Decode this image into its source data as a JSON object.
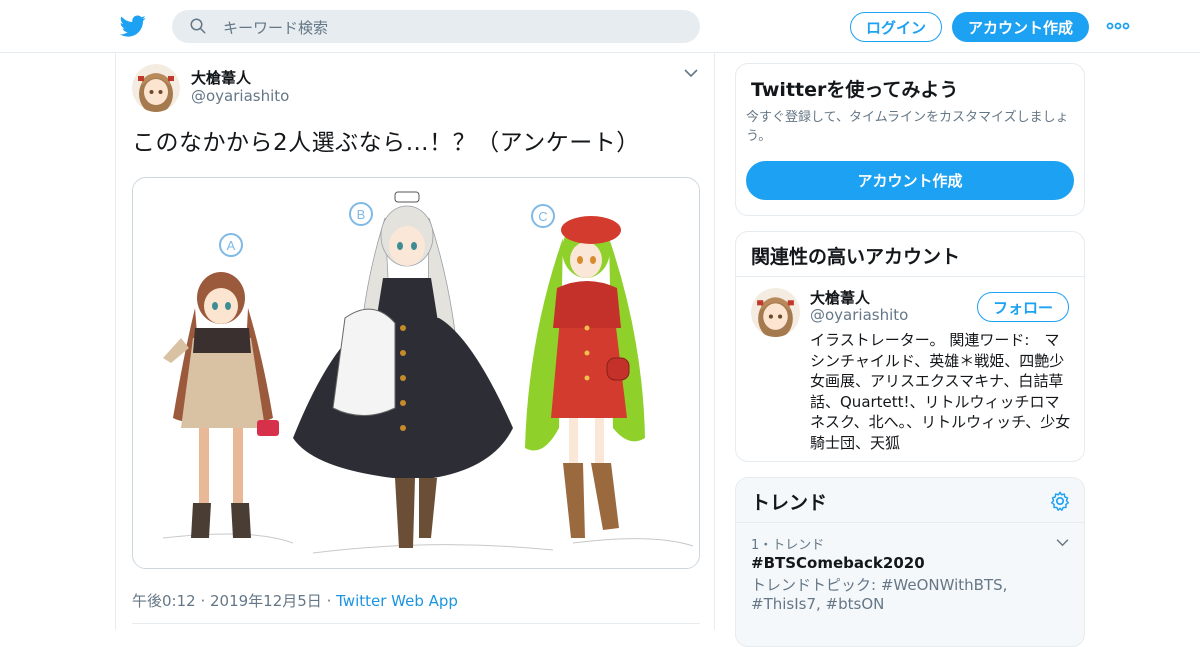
{
  "header": {
    "search_placeholder": "キーワード検索",
    "login_label": "ログイン",
    "signup_label": "アカウント作成"
  },
  "tweet": {
    "author_name": "大槍葦人",
    "author_handle": "@oyariashito",
    "text": "このなかから2人選ぶなら…！？（アンケート）",
    "timestamp": "午後0:12 · 2019年12月5日",
    "source": "Twitter Web App",
    "media_labels": {
      "a": "A",
      "b": "B",
      "c": "C"
    }
  },
  "signup_card": {
    "title": "Twitterを使ってみよう",
    "subtitle": "今すぐ登録して、タイムラインをカスタマイズしましょう。",
    "button_label": "アカウント作成"
  },
  "related": {
    "title": "関連性の高いアカウント",
    "account": {
      "name": "大槍葦人",
      "handle": "@oyariashito",
      "follow_label": "フォロー",
      "bio": "イラストレーター。 関連ワード:　マシンチャイルド、英雄＊戦姫、四艶少女画展、アリスエクスマキナ、白詰草話、Quartett!、リトルウィッチロマネスク、北へ。、リトルウィッチ、少女騎士団、天狐"
    }
  },
  "trends": {
    "title": "トレンド",
    "items": [
      {
        "rank": "1・トレンド",
        "tag": "#BTSComeback2020",
        "topic": "トレンドトピック: #WeONWithBTS, #ThisIs7, #btsON"
      }
    ]
  },
  "colors": {
    "accent": "#1da1f2",
    "border": "#e6ecf0",
    "muted": "#657786"
  }
}
